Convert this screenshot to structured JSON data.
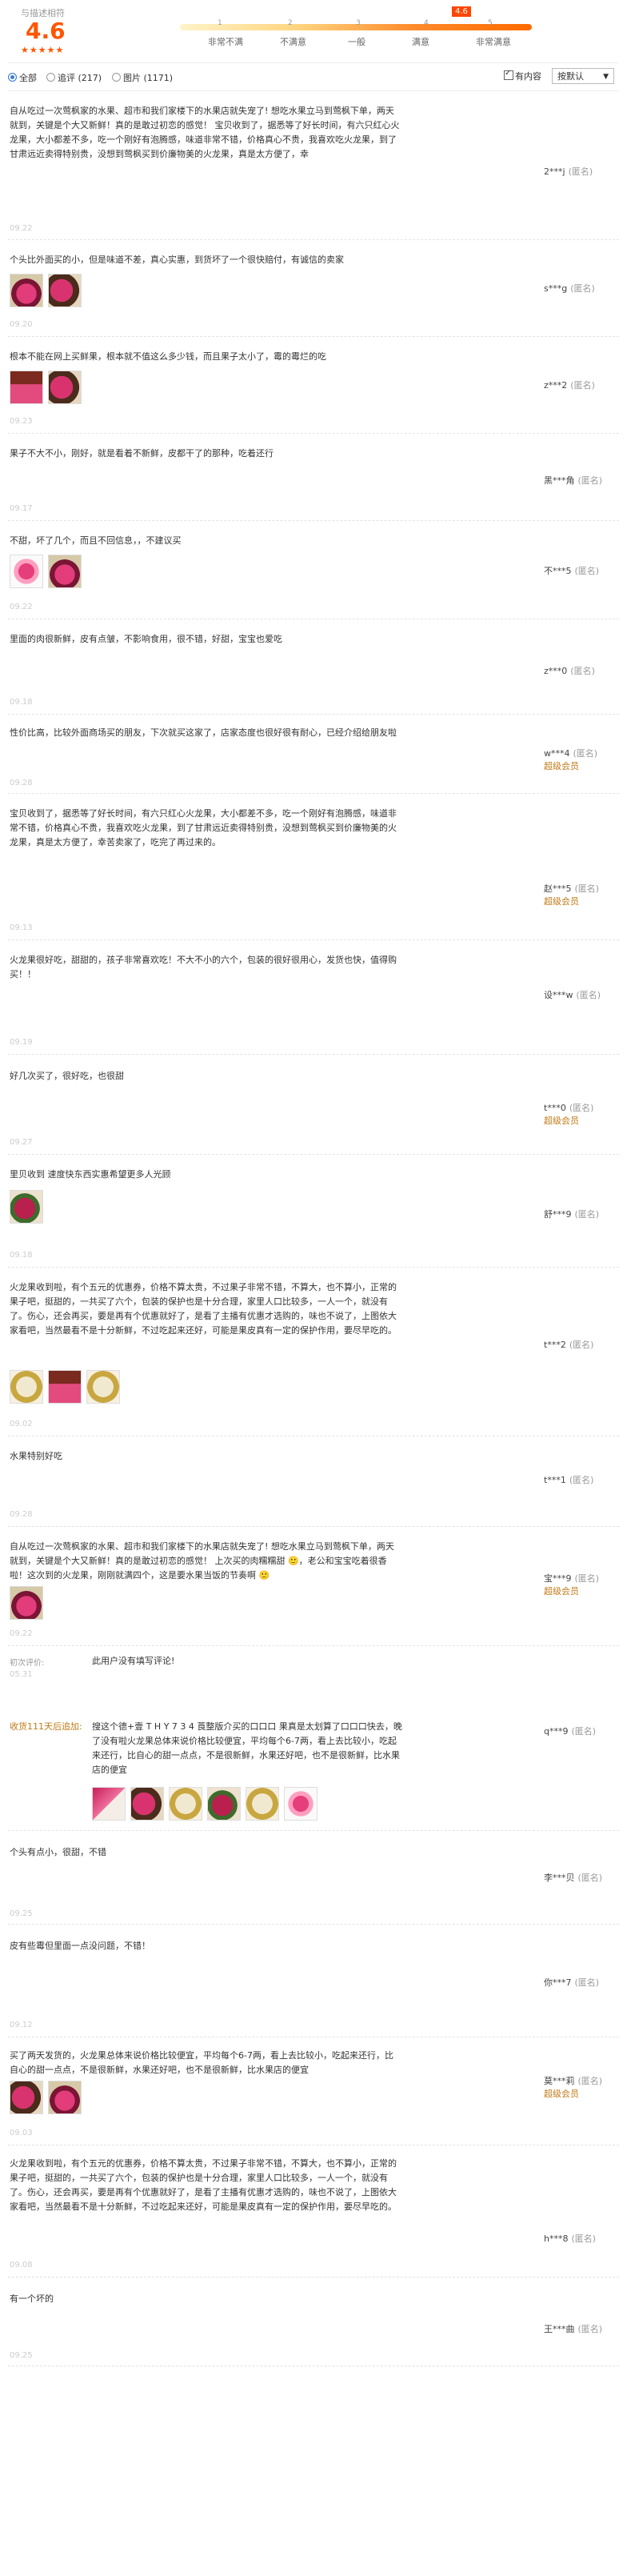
{
  "summary": {
    "label": "与描述相符",
    "score": "4.6",
    "stars": "★★★★★",
    "pointer": "4.6",
    "ticks": [
      "1",
      "2",
      "3",
      "4",
      "5"
    ],
    "tick_labels": [
      "非常不满",
      "不满意",
      "一般",
      "满意",
      "非常满意"
    ]
  },
  "toolbar": {
    "all": "全部",
    "append": "追评 (217)",
    "pics": "图片 (1171)",
    "has_content": "有内容",
    "sort": "按默认"
  },
  "reviews": [
    {
      "text": "自从吃过一次莺枫家的水果、超市和我们家楼下的水果店就失宠了! 想吃水果立马到莺枫下单，两天就到，关键是个大又新鲜！真的是敢过初恋的感觉！ 宝贝收到了，据悉等了好长时间，有六只红心火龙果，大小都差不多，吃一个刚好有泡腾感，味道非常不错，价格真心不贵，我喜欢吃火龙果，到了甘肃远近卖得特别贵，没想到莺枫买到价廉物美的火龙果，真是太方便了，幸",
      "date": "09.22",
      "user": "2***j",
      "anon": "(匿名)",
      "vip": ""
    },
    {
      "text": "个头比外面买的小，但是味道不差，真心实惠，到货坏了一个很快赔付，有诚信的卖家",
      "date": "09.20",
      "user": "s***g",
      "anon": "(匿名)",
      "vip": ""
    },
    {
      "text": "根本不能在网上买鲜果，根本就不值这么多少钱，而且果子太小了，霉的霉烂的吃",
      "date": "09.23",
      "user": "z***2",
      "anon": "(匿名)",
      "vip": ""
    },
    {
      "text": "果子不大不小，刚好，就是看着不新鲜，皮都干了的那种，吃着还行",
      "date": "09.17",
      "user": "黑***角",
      "anon": "(匿名)",
      "vip": ""
    },
    {
      "text": "不甜，坏了几个，而且不回信息，，不建议买",
      "date": "09.22",
      "user": "不***5",
      "anon": "(匿名)",
      "vip": ""
    },
    {
      "text": "里面的肉很新鲜，皮有点皱，不影响食用，很不错，好甜，宝宝也爱吃",
      "date": "09.18",
      "user": "z***0",
      "anon": "(匿名)",
      "vip": ""
    },
    {
      "text": "性价比高，比较外面商场买的朋友，下次就买这家了，店家态度也很好很有耐心，已经介绍给朋友啦",
      "date": "09.28",
      "user": "w***4",
      "anon": "(匿名)",
      "vip": "超级会员"
    },
    {
      "text": "宝贝收到了，据悉等了好长时间，有六只红心火龙果，大小都差不多，吃一个刚好有泡腾感，味道非常不错，价格真心不贵，我喜欢吃火龙果，到了甘肃远近卖得特别贵，没想到莺枫买到价廉物美的火龙果，真是太方便了，幸苦卖家了，吃完了再过来的。",
      "date": "09.13",
      "user": "赵***5",
      "anon": "(匿名)",
      "vip": "超级会员"
    },
    {
      "text": "火龙果很好吃，甜甜的，孩子非常喜欢吃！不大不小的六个，包装的很好很用心，发货也快，值得购买！！",
      "date": "09.19",
      "user": "设***w",
      "anon": "(匿名)",
      "vip": ""
    },
    {
      "text": "好几次买了，很好吃，也很甜",
      "date": "09.27",
      "user": "t***0",
      "anon": "(匿名)",
      "vip": "超级会员"
    },
    {
      "text": "里贝收到 速度快东西实惠希望更多人光顾",
      "date": "09.18",
      "user": "舒***9",
      "anon": "(匿名)",
      "vip": ""
    },
    {
      "text": "火龙果收到啦，有个五元的优惠券，价格不算太贵，不过果子非常不错，不算大，也不算小，正常的果子吧，挺甜的，一共买了六个，包装的保护也是十分合理，家里人口比较多，一人一个，就没有了。伤心，还会再买，要是再有个优惠就好了，是看了主播有优惠才选购的，味也不说了，上图依大家看吧，当然最看不是十分新鲜，不过吃起来还好，可能是果皮真有一定的保护作用，要尽早吃的。",
      "date": "09.02",
      "user": "t***2",
      "anon": "(匿名)",
      "vip": ""
    },
    {
      "text": "水果特别好吃",
      "date": "09.28",
      "user": "t***1",
      "anon": "(匿名)",
      "vip": ""
    },
    {
      "text": "自从吃过一次莺枫家的水果、超市和我们家楼下的水果店就失宠了! 想吃水果立马到莺枫下单，两天就到，关键是个大又新鲜！真的是敢过初恋的感觉！ 上次买的肉糯糯甜 🙂，老公和宝宝吃着很香啦！这次到的火龙果，刚刚就满四个，这是要水果当饭的节奏啊 🙂",
      "date": "09.22",
      "user": "宝***9",
      "anon": "(匿名)",
      "vip": "超级会员"
    },
    {
      "text": "此用户没有填写评论!",
      "date": "05.31",
      "user": "q***9",
      "anon": "(匿名)",
      "vip": "",
      "first_label": "初次评价:",
      "follow_label": "收货111天后追加:",
      "follow_text": "搜这个德+壹 T H Y 7 3 4 莨整版介买的口口口 果真是太划算了口口口快去，晚了没有啦火龙果总体来说价格比较便宜，平均每个6-7两，看上去比较小，吃起来还行，比自心的甜一点点，不是很新鲜，水果还好吧，也不是很新鲜，比水果店的便宜"
    },
    {
      "text": "个头有点小，很甜，不错",
      "date": "09.25",
      "user": "李***贝",
      "anon": "(匿名)",
      "vip": ""
    },
    {
      "text": "皮有些霉但里面一点没问题，不错！",
      "date": "09.12",
      "user": "你***7",
      "anon": "(匿名)",
      "vip": ""
    },
    {
      "text": "买了两天发货的，火龙果总体来说价格比较便宜，平均每个6-7两，看上去比较小，吃起来还行，比自心的甜一点点，不是很新鲜，水果还好吧，也不是很新鲜，比水果店的便宜",
      "date": "09.03",
      "user": "莫***莉",
      "anon": "(匿名)",
      "vip": "超级会员"
    },
    {
      "text": "火龙果收到啦，有个五元的优惠券，价格不算太贵，不过果子非常不错，不算大，也不算小，正常的果子吧，挺甜的，一共买了六个，包装的保护也是十分合理，家里人口比较多，一人一个，就没有了。伤心，还会再买，要是再有个优惠就好了，是看了主播有优惠才选购的，味也不说了，上图依大家看吧，当然最看不是十分新鲜，不过吃起来还好，可能是果皮真有一定的保护作用，要尽早吃的。",
      "date": "09.08",
      "user": "h***8",
      "anon": "(匿名)",
      "vip": ""
    },
    {
      "text": "有一个坏的",
      "date": "09.25",
      "user": "王***曲",
      "anon": "(匿名)",
      "vip": ""
    }
  ]
}
